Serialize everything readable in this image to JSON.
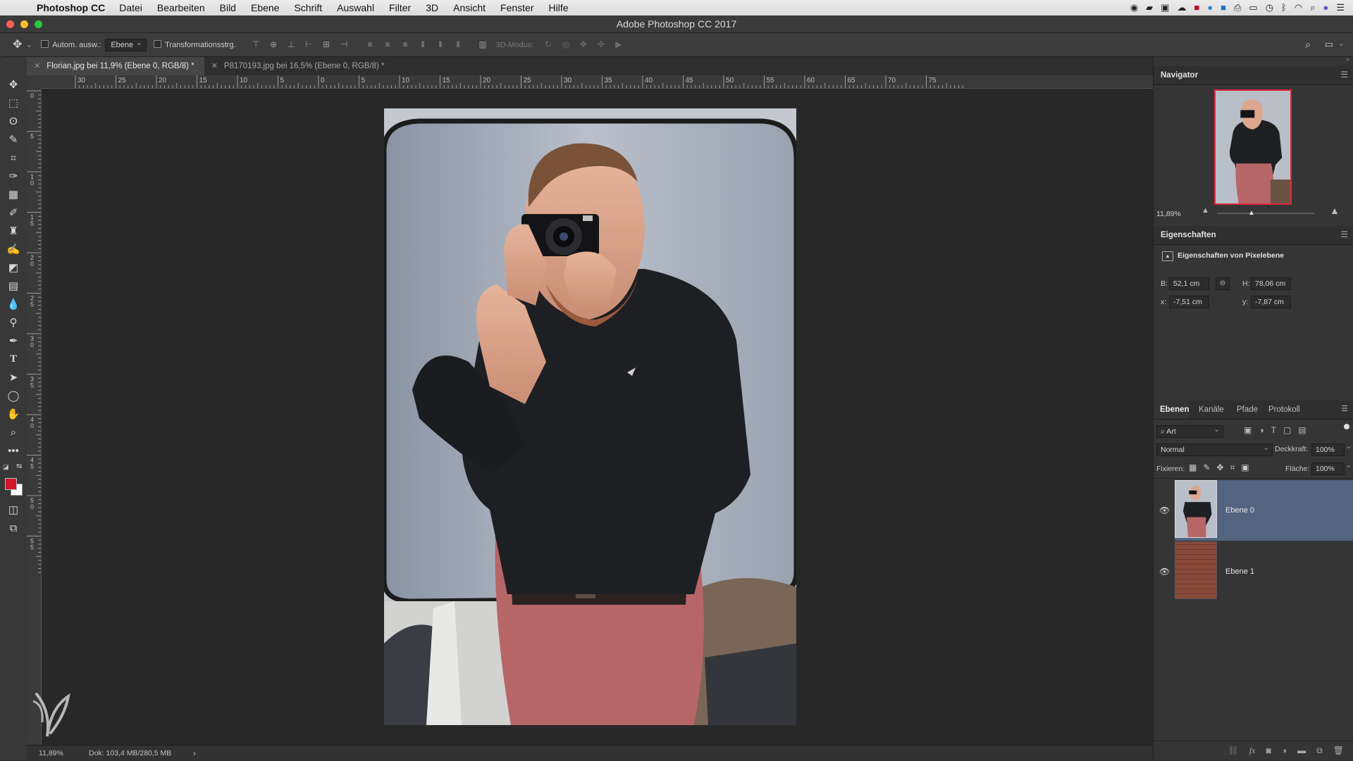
{
  "menubar": {
    "app_name": "Photoshop CC",
    "items": [
      "Datei",
      "Bearbeiten",
      "Bild",
      "Ebene",
      "Schrift",
      "Auswahl",
      "Filter",
      "3D",
      "Ansicht",
      "Fenster",
      "Hilfe"
    ]
  },
  "window": {
    "title": "Adobe Photoshop CC 2017"
  },
  "options": {
    "auto_select_label": "Autom. ausw.:",
    "auto_select_target": "Ebene",
    "transform_label": "Transformationsstrg.",
    "mode_3d_label": "3D-Modus:"
  },
  "tabs": [
    {
      "label": "Florian.jpg bei 11,9% (Ebene 0, RGB/8) *",
      "active": true
    },
    {
      "label": "P8170193.jpg bei 16,5% (Ebene 0, RGB/8) *",
      "active": false
    }
  ],
  "ruler": {
    "h_labels": [
      "30",
      "25",
      "20",
      "15",
      "10",
      "5",
      "0",
      "5",
      "10",
      "15",
      "20",
      "25",
      "30",
      "35",
      "40",
      "45",
      "50",
      "55",
      "60",
      "65",
      "70",
      "75"
    ],
    "v_labels": [
      "0",
      "5",
      "10",
      "15",
      "20",
      "25",
      "30",
      "35",
      "40",
      "45",
      "50",
      "55"
    ]
  },
  "status": {
    "zoom": "11,89%",
    "doc": "Dok: 103,4 MB/280,5 MB",
    "arrow": "›"
  },
  "navigator": {
    "title": "Navigator",
    "zoom": "11,89%"
  },
  "properties": {
    "title": "Eigenschaften",
    "subtitle": "Eigenschaften von Pixelebene",
    "w_label": "B:",
    "w_value": "52,1 cm",
    "h_label": "H:",
    "h_value": "78,06 cm",
    "x_label": "x:",
    "x_value": "-7,51 cm",
    "y_label": "y:",
    "y_value": "-7,87 cm"
  },
  "layers_panel": {
    "tabs": [
      "Ebenen",
      "Kanäle",
      "Pfade",
      "Protokoll"
    ],
    "filter_kind": "Art",
    "blend_mode": "Normal",
    "opacity_label": "Deckkraft:",
    "opacity_value": "100%",
    "lock_label": "Fixieren:",
    "fill_label": "Fläche:",
    "fill_value": "100%",
    "layers": [
      {
        "name": "Ebene 0",
        "selected": true
      },
      {
        "name": "Ebene 1",
        "selected": false
      }
    ]
  },
  "colors": {
    "selected_layer": "#536481",
    "foreground": "#d1172c",
    "background": "#ffffff"
  }
}
